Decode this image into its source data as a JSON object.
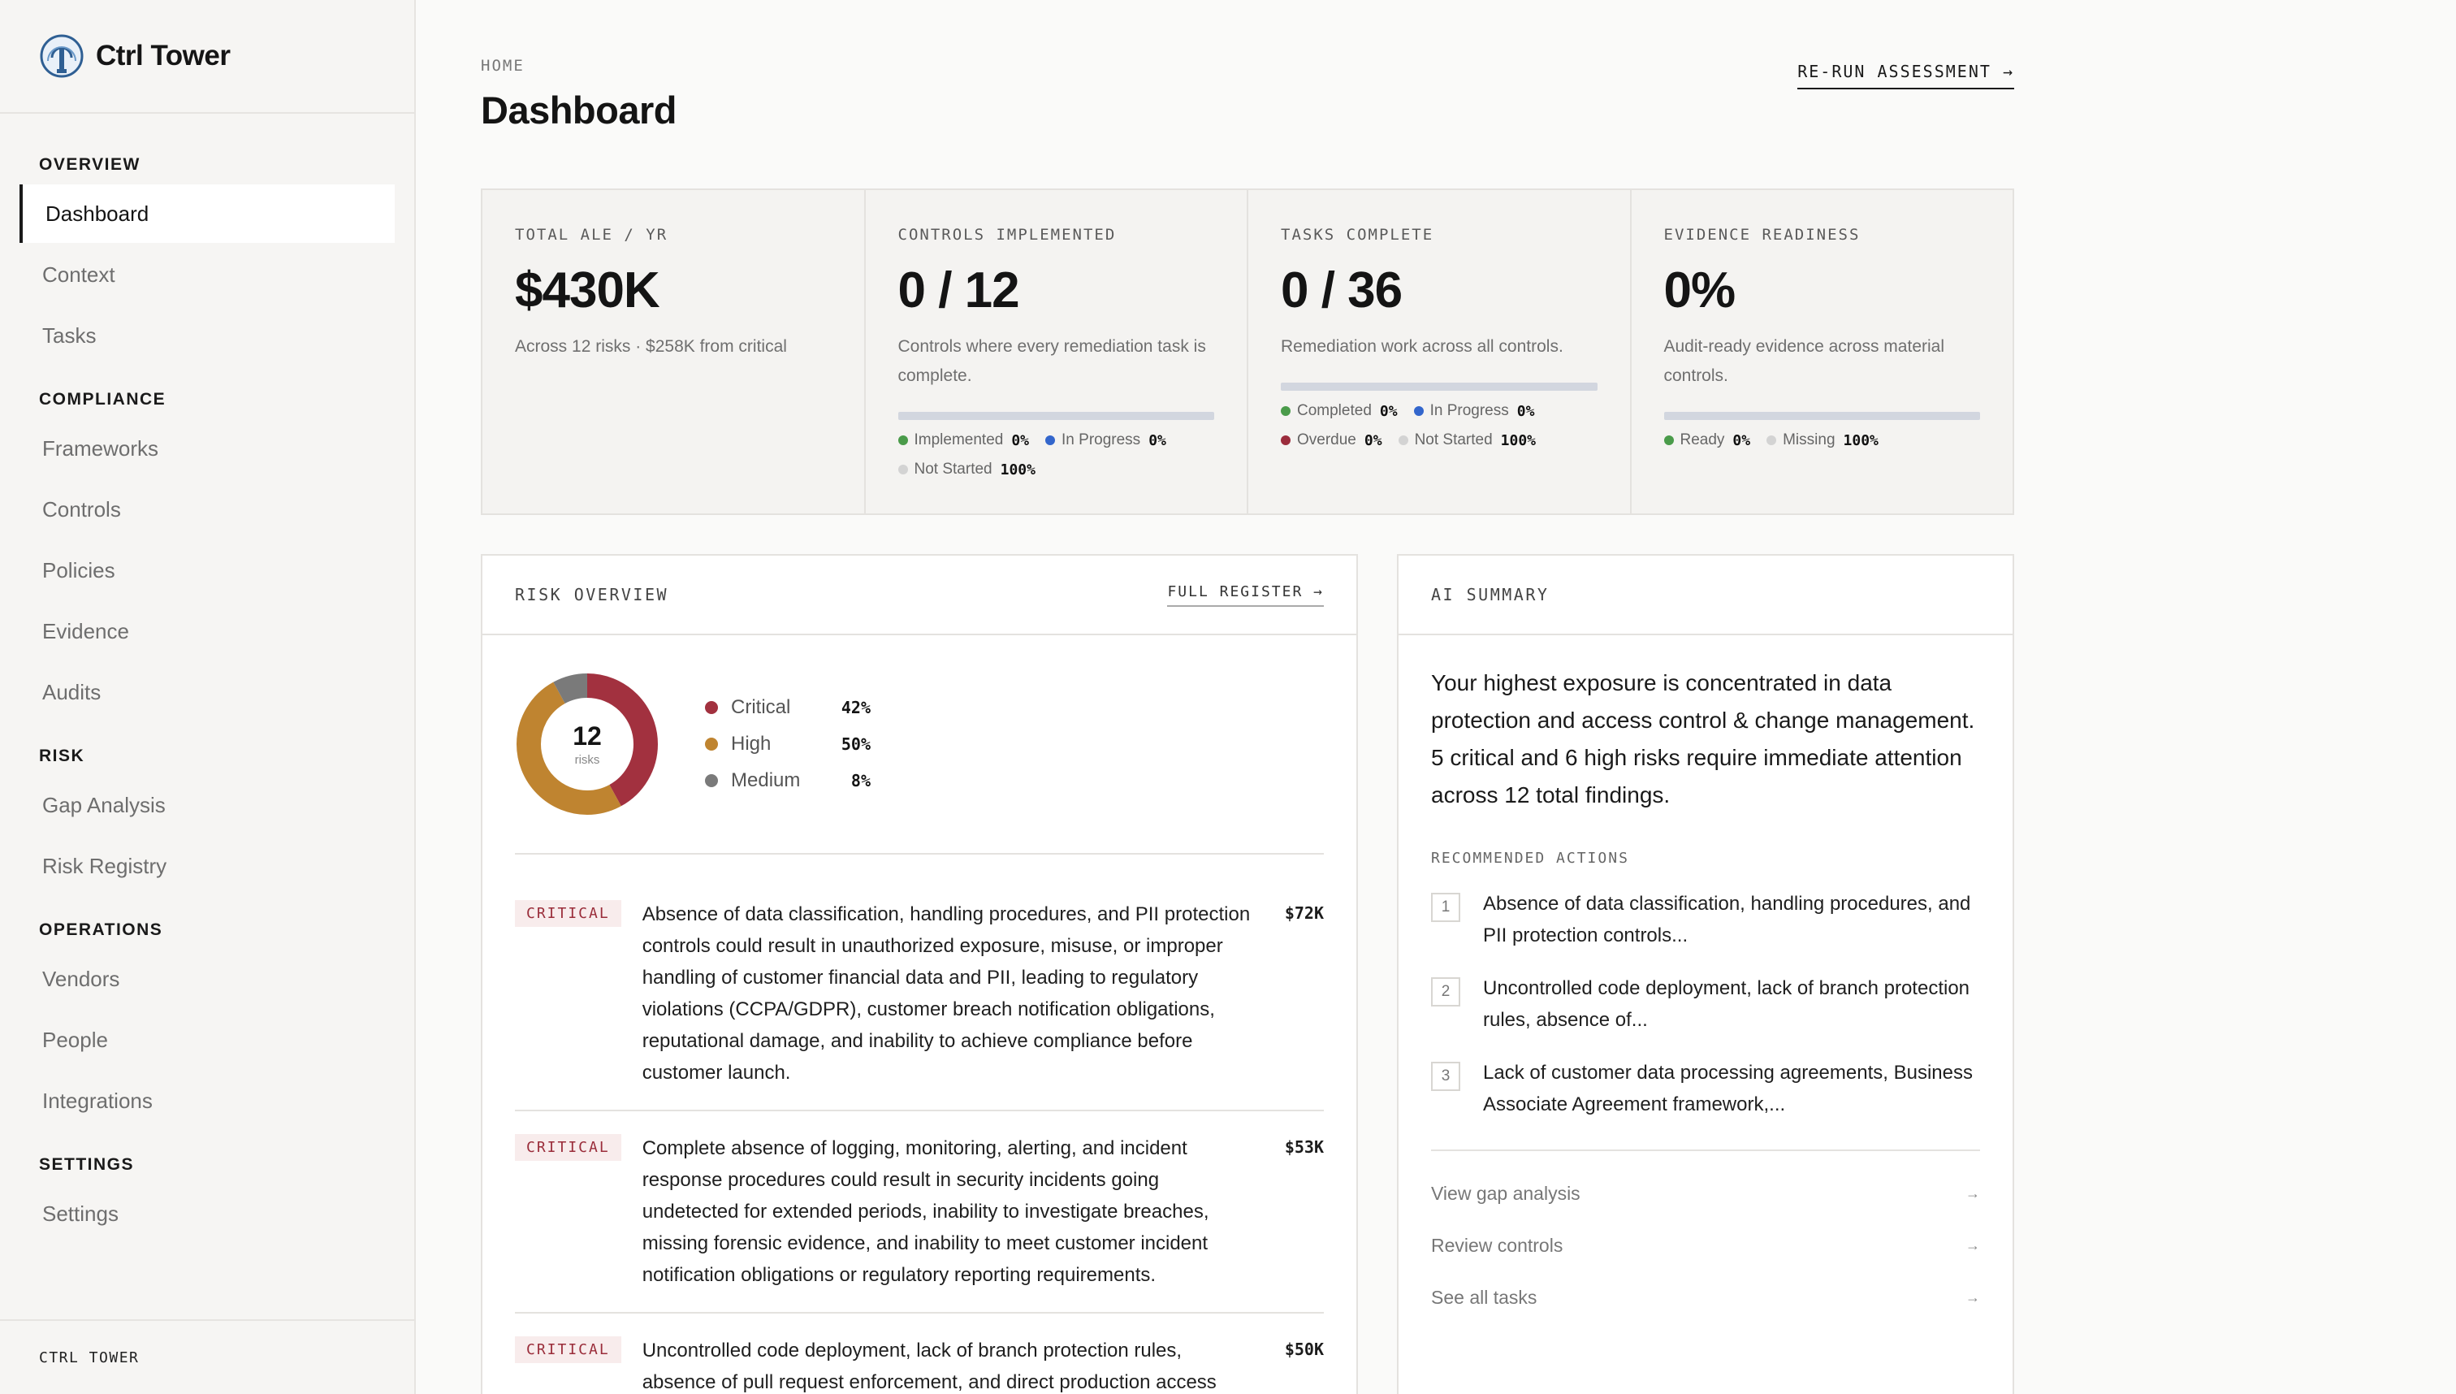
{
  "brand": {
    "name": "Ctrl Tower"
  },
  "sidebar": {
    "sections": [
      {
        "heading": "OVERVIEW",
        "items": [
          "Dashboard",
          "Context",
          "Tasks"
        ]
      },
      {
        "heading": "COMPLIANCE",
        "items": [
          "Frameworks",
          "Controls",
          "Policies",
          "Evidence",
          "Audits"
        ]
      },
      {
        "heading": "RISK",
        "items": [
          "Gap Analysis",
          "Risk Registry"
        ]
      },
      {
        "heading": "OPERATIONS",
        "items": [
          "Vendors",
          "People",
          "Integrations"
        ]
      },
      {
        "heading": "SETTINGS",
        "items": [
          "Settings"
        ]
      }
    ],
    "active_item": "Dashboard",
    "footer": "CTRL TOWER"
  },
  "header": {
    "breadcrumb": "HOME",
    "title": "Dashboard",
    "rerun_label": "RE-RUN ASSESSMENT →"
  },
  "stats": {
    "ale": {
      "label": "TOTAL ALE / YR",
      "value": "$430K",
      "desc": "Across 12 risks · $258K from critical"
    },
    "controls": {
      "label": "CONTROLS IMPLEMENTED",
      "value": "0 / 12",
      "desc": "Controls where every remediation task is complete.",
      "progress": 0,
      "legend": [
        {
          "name": "Implemented",
          "pct": "0%",
          "color": "#4a9b4a"
        },
        {
          "name": "In Progress",
          "pct": "0%",
          "color": "#3366cc"
        },
        {
          "name": "Not Started",
          "pct": "100%",
          "color": "#d3d3d3"
        }
      ]
    },
    "tasks": {
      "label": "TASKS COMPLETE",
      "value": "0 / 36",
      "desc": "Remediation work across all controls.",
      "progress": 0,
      "legend": [
        {
          "name": "Completed",
          "pct": "0%",
          "color": "#4a9b4a"
        },
        {
          "name": "In Progress",
          "pct": "0%",
          "color": "#3366cc"
        },
        {
          "name": "Overdue",
          "pct": "0%",
          "color": "#9b2c3c"
        },
        {
          "name": "Not Started",
          "pct": "100%",
          "color": "#d3d3d3"
        }
      ]
    },
    "evidence": {
      "label": "EVIDENCE READINESS",
      "value": "0%",
      "desc": "Audit-ready evidence across material controls.",
      "progress": 0,
      "legend": [
        {
          "name": "Ready",
          "pct": "0%",
          "color": "#4a9b4a"
        },
        {
          "name": "Missing",
          "pct": "100%",
          "color": "#d3d3d3"
        }
      ]
    }
  },
  "risk_overview": {
    "title": "RISK OVERVIEW",
    "link": "FULL REGISTER →",
    "total": "12",
    "total_unit": "risks",
    "distribution": [
      {
        "name": "Critical",
        "pct": "42%",
        "value": 42,
        "color": "#a2313f"
      },
      {
        "name": "High",
        "pct": "50%",
        "value": 50,
        "color": "#bf8430"
      },
      {
        "name": "Medium",
        "pct": "8%",
        "value": 8,
        "color": "#7a7a7a"
      }
    ],
    "risks": [
      {
        "severity": "CRITICAL",
        "amount": "$72K",
        "text": "Absence of data classification, handling procedures, and PII protection controls could result in unauthorized exposure, misuse, or improper handling of customer financial data and PII, leading to regulatory violations (CCPA/GDPR), customer breach notification obligations, reputational damage, and inability to achieve compliance before customer launch."
      },
      {
        "severity": "CRITICAL",
        "amount": "$53K",
        "text": "Complete absence of logging, monitoring, alerting, and incident response procedures could result in security incidents going undetected for extended periods, inability to investigate breaches, missing forensic evidence, and inability to meet customer incident notification obligations or regulatory reporting requirements."
      },
      {
        "severity": "CRITICAL",
        "amount": "$50K",
        "text": "Uncontrolled code deployment, lack of branch protection rules, absence of pull request enforcement, and direct production access"
      }
    ]
  },
  "ai_summary": {
    "title": "AI SUMMARY",
    "summary": "Your highest exposure is concentrated in data protection and access control & change management. 5 critical and 6 high risks require immediate attention across 12 total findings.",
    "rec_title": "RECOMMENDED ACTIONS",
    "actions": [
      {
        "num": "1",
        "text": "Absence of data classification, handling procedures, and PII protection controls..."
      },
      {
        "num": "2",
        "text": "Uncontrolled code deployment, lack of branch protection rules, absence of..."
      },
      {
        "num": "3",
        "text": "Lack of customer data processing agreements, Business Associate Agreement framework,..."
      }
    ],
    "links": [
      "View gap analysis",
      "Review controls",
      "See all tasks"
    ],
    "link_arrow": "→"
  }
}
